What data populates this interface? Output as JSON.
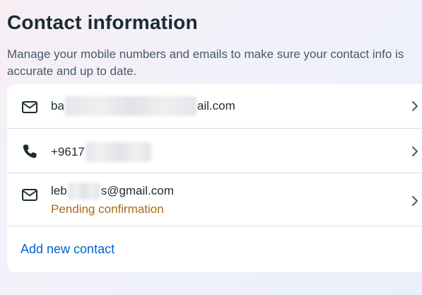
{
  "page": {
    "title": "Contact information",
    "description": "Manage your mobile numbers and emails to make sure your contact info is accurate and up to date."
  },
  "contacts": [
    {
      "icon": "mail-icon",
      "value_start": "ba",
      "value_end": "ail.com"
    },
    {
      "icon": "phone-icon",
      "value_start": "+9617",
      "value_end": ""
    },
    {
      "icon": "mail-icon",
      "value_start": "leb",
      "value_end": "s@gmail.com",
      "status": "Pending confirmation"
    }
  ],
  "actions": {
    "add_contact": "Add new contact"
  },
  "colors": {
    "text_primary": "#1c2b33",
    "text_secondary": "#465a69",
    "pending": "#a86a1b",
    "link": "#0064d1",
    "divider": "#dadde1"
  }
}
